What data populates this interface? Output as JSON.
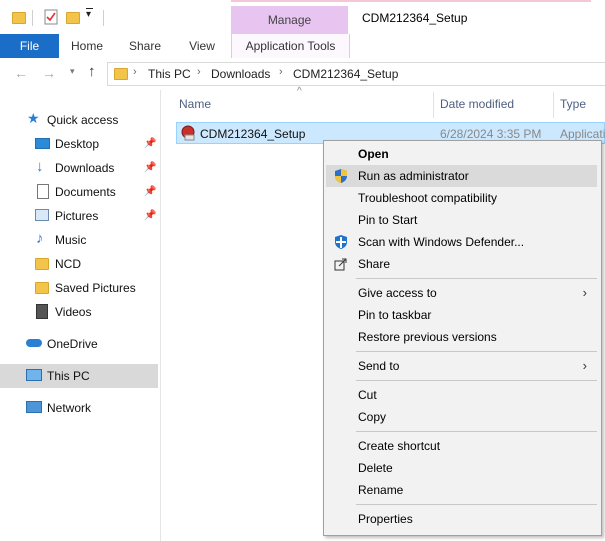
{
  "window": {
    "title": "CDM212364_Setup",
    "contextual_tab_group": "Manage",
    "contextual_tab": "Application Tools"
  },
  "ribbon": {
    "tabs": [
      "File",
      "Home",
      "Share",
      "View"
    ]
  },
  "address_bar": {
    "crumbs": [
      "This PC",
      "Downloads",
      "CDM212364_Setup"
    ]
  },
  "nav_pane": {
    "quick_access": "Quick access",
    "items": [
      {
        "label": "Desktop",
        "pinned": true
      },
      {
        "label": "Downloads",
        "pinned": true
      },
      {
        "label": "Documents",
        "pinned": true
      },
      {
        "label": "Pictures",
        "pinned": true
      },
      {
        "label": "Music",
        "pinned": false
      },
      {
        "label": "NCD",
        "pinned": false
      },
      {
        "label": "Saved Pictures",
        "pinned": false
      },
      {
        "label": "Videos",
        "pinned": false
      }
    ],
    "onedrive": "OneDrive",
    "this_pc": "This PC",
    "network": "Network"
  },
  "columns": {
    "name": "Name",
    "date_modified": "Date modified",
    "type": "Type"
  },
  "file": {
    "name": "CDM212364_Setup",
    "date_modified": "6/28/2024 3:35 PM",
    "type": "Applicati"
  },
  "context_menu": {
    "open": "Open",
    "run_as_admin": "Run as administrator",
    "troubleshoot": "Troubleshoot compatibility",
    "pin_start": "Pin to Start",
    "scan_defender": "Scan with Windows Defender...",
    "share": "Share",
    "give_access": "Give access to",
    "pin_taskbar": "Pin to taskbar",
    "restore": "Restore previous versions",
    "send_to": "Send to",
    "cut": "Cut",
    "copy": "Copy",
    "create_shortcut": "Create shortcut",
    "delete": "Delete",
    "rename": "Rename",
    "properties": "Properties"
  },
  "colors": {
    "file_tab": "#1a6ec7",
    "manage_tab": "#e8c4f0",
    "selection": "#cce8ff",
    "menu_bg": "#f2f2f2"
  }
}
